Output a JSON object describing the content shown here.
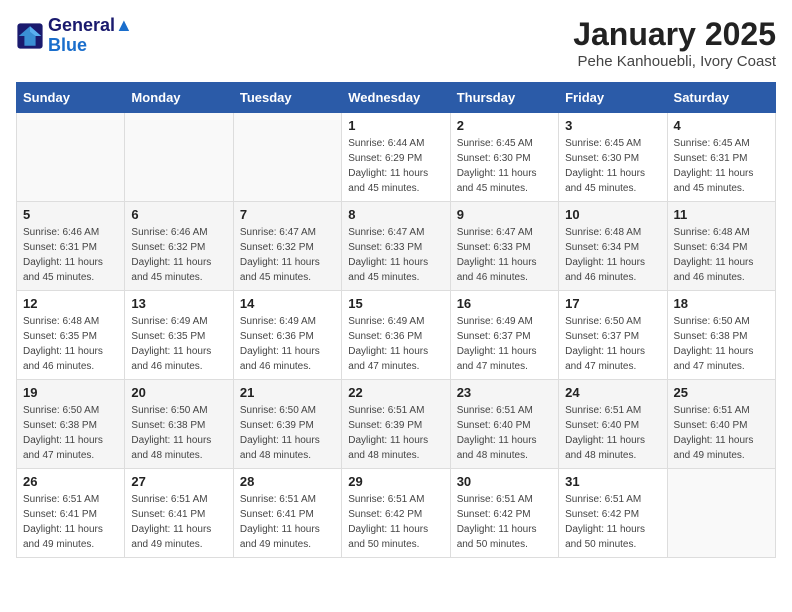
{
  "header": {
    "logo_line1": "General",
    "logo_line2": "Blue",
    "month_title": "January 2025",
    "location": "Pehe Kanhouebli, Ivory Coast"
  },
  "days_of_week": [
    "Sunday",
    "Monday",
    "Tuesday",
    "Wednesday",
    "Thursday",
    "Friday",
    "Saturday"
  ],
  "weeks": [
    [
      {
        "day": "",
        "info": ""
      },
      {
        "day": "",
        "info": ""
      },
      {
        "day": "",
        "info": ""
      },
      {
        "day": "1",
        "info": "Sunrise: 6:44 AM\nSunset: 6:29 PM\nDaylight: 11 hours and 45 minutes."
      },
      {
        "day": "2",
        "info": "Sunrise: 6:45 AM\nSunset: 6:30 PM\nDaylight: 11 hours and 45 minutes."
      },
      {
        "day": "3",
        "info": "Sunrise: 6:45 AM\nSunset: 6:30 PM\nDaylight: 11 hours and 45 minutes."
      },
      {
        "day": "4",
        "info": "Sunrise: 6:45 AM\nSunset: 6:31 PM\nDaylight: 11 hours and 45 minutes."
      }
    ],
    [
      {
        "day": "5",
        "info": "Sunrise: 6:46 AM\nSunset: 6:31 PM\nDaylight: 11 hours and 45 minutes."
      },
      {
        "day": "6",
        "info": "Sunrise: 6:46 AM\nSunset: 6:32 PM\nDaylight: 11 hours and 45 minutes."
      },
      {
        "day": "7",
        "info": "Sunrise: 6:47 AM\nSunset: 6:32 PM\nDaylight: 11 hours and 45 minutes."
      },
      {
        "day": "8",
        "info": "Sunrise: 6:47 AM\nSunset: 6:33 PM\nDaylight: 11 hours and 45 minutes."
      },
      {
        "day": "9",
        "info": "Sunrise: 6:47 AM\nSunset: 6:33 PM\nDaylight: 11 hours and 46 minutes."
      },
      {
        "day": "10",
        "info": "Sunrise: 6:48 AM\nSunset: 6:34 PM\nDaylight: 11 hours and 46 minutes."
      },
      {
        "day": "11",
        "info": "Sunrise: 6:48 AM\nSunset: 6:34 PM\nDaylight: 11 hours and 46 minutes."
      }
    ],
    [
      {
        "day": "12",
        "info": "Sunrise: 6:48 AM\nSunset: 6:35 PM\nDaylight: 11 hours and 46 minutes."
      },
      {
        "day": "13",
        "info": "Sunrise: 6:49 AM\nSunset: 6:35 PM\nDaylight: 11 hours and 46 minutes."
      },
      {
        "day": "14",
        "info": "Sunrise: 6:49 AM\nSunset: 6:36 PM\nDaylight: 11 hours and 46 minutes."
      },
      {
        "day": "15",
        "info": "Sunrise: 6:49 AM\nSunset: 6:36 PM\nDaylight: 11 hours and 47 minutes."
      },
      {
        "day": "16",
        "info": "Sunrise: 6:49 AM\nSunset: 6:37 PM\nDaylight: 11 hours and 47 minutes."
      },
      {
        "day": "17",
        "info": "Sunrise: 6:50 AM\nSunset: 6:37 PM\nDaylight: 11 hours and 47 minutes."
      },
      {
        "day": "18",
        "info": "Sunrise: 6:50 AM\nSunset: 6:38 PM\nDaylight: 11 hours and 47 minutes."
      }
    ],
    [
      {
        "day": "19",
        "info": "Sunrise: 6:50 AM\nSunset: 6:38 PM\nDaylight: 11 hours and 47 minutes."
      },
      {
        "day": "20",
        "info": "Sunrise: 6:50 AM\nSunset: 6:38 PM\nDaylight: 11 hours and 48 minutes."
      },
      {
        "day": "21",
        "info": "Sunrise: 6:50 AM\nSunset: 6:39 PM\nDaylight: 11 hours and 48 minutes."
      },
      {
        "day": "22",
        "info": "Sunrise: 6:51 AM\nSunset: 6:39 PM\nDaylight: 11 hours and 48 minutes."
      },
      {
        "day": "23",
        "info": "Sunrise: 6:51 AM\nSunset: 6:40 PM\nDaylight: 11 hours and 48 minutes."
      },
      {
        "day": "24",
        "info": "Sunrise: 6:51 AM\nSunset: 6:40 PM\nDaylight: 11 hours and 48 minutes."
      },
      {
        "day": "25",
        "info": "Sunrise: 6:51 AM\nSunset: 6:40 PM\nDaylight: 11 hours and 49 minutes."
      }
    ],
    [
      {
        "day": "26",
        "info": "Sunrise: 6:51 AM\nSunset: 6:41 PM\nDaylight: 11 hours and 49 minutes."
      },
      {
        "day": "27",
        "info": "Sunrise: 6:51 AM\nSunset: 6:41 PM\nDaylight: 11 hours and 49 minutes."
      },
      {
        "day": "28",
        "info": "Sunrise: 6:51 AM\nSunset: 6:41 PM\nDaylight: 11 hours and 49 minutes."
      },
      {
        "day": "29",
        "info": "Sunrise: 6:51 AM\nSunset: 6:42 PM\nDaylight: 11 hours and 50 minutes."
      },
      {
        "day": "30",
        "info": "Sunrise: 6:51 AM\nSunset: 6:42 PM\nDaylight: 11 hours and 50 minutes."
      },
      {
        "day": "31",
        "info": "Sunrise: 6:51 AM\nSunset: 6:42 PM\nDaylight: 11 hours and 50 minutes."
      },
      {
        "day": "",
        "info": ""
      }
    ]
  ]
}
